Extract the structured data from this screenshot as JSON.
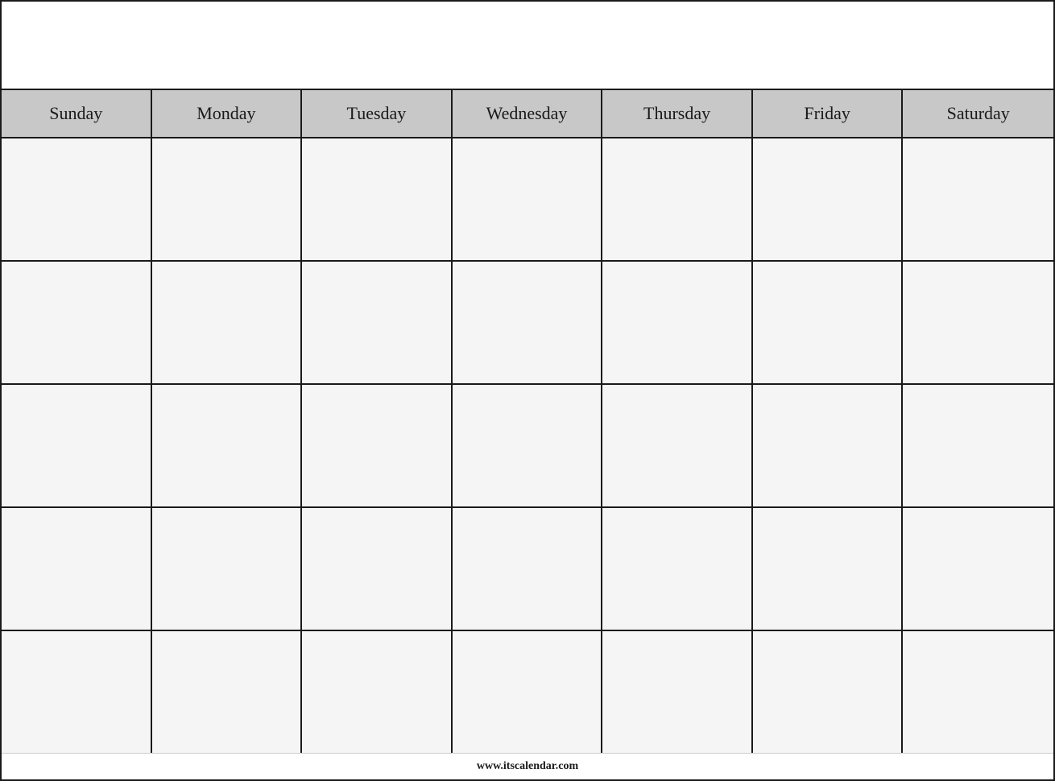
{
  "calendar": {
    "header": {
      "title": ""
    },
    "days": [
      {
        "label": "Sunday"
      },
      {
        "label": "Monday"
      },
      {
        "label": "Tuesday"
      },
      {
        "label": "Wednesday"
      },
      {
        "label": "Thursday"
      },
      {
        "label": "Friday"
      },
      {
        "label": "Saturday"
      }
    ],
    "rows": 5,
    "footer": {
      "url": "www.itscalendar.com"
    }
  }
}
